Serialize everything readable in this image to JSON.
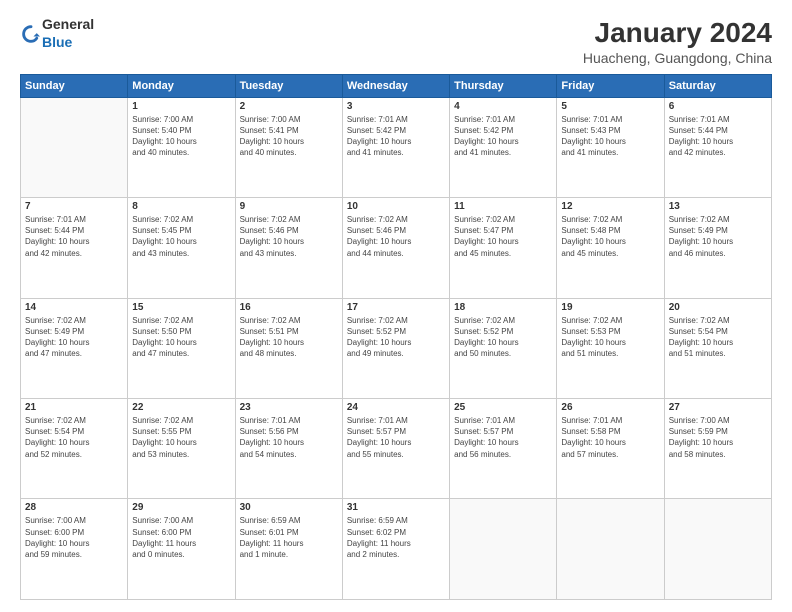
{
  "logo": {
    "general": "General",
    "blue": "Blue"
  },
  "header": {
    "title": "January 2024",
    "subtitle": "Huacheng, Guangdong, China"
  },
  "weekdays": [
    "Sunday",
    "Monday",
    "Tuesday",
    "Wednesday",
    "Thursday",
    "Friday",
    "Saturday"
  ],
  "weeks": [
    [
      {
        "day": "",
        "info": ""
      },
      {
        "day": "1",
        "info": "Sunrise: 7:00 AM\nSunset: 5:40 PM\nDaylight: 10 hours\nand 40 minutes."
      },
      {
        "day": "2",
        "info": "Sunrise: 7:00 AM\nSunset: 5:41 PM\nDaylight: 10 hours\nand 40 minutes."
      },
      {
        "day": "3",
        "info": "Sunrise: 7:01 AM\nSunset: 5:42 PM\nDaylight: 10 hours\nand 41 minutes."
      },
      {
        "day": "4",
        "info": "Sunrise: 7:01 AM\nSunset: 5:42 PM\nDaylight: 10 hours\nand 41 minutes."
      },
      {
        "day": "5",
        "info": "Sunrise: 7:01 AM\nSunset: 5:43 PM\nDaylight: 10 hours\nand 41 minutes."
      },
      {
        "day": "6",
        "info": "Sunrise: 7:01 AM\nSunset: 5:44 PM\nDaylight: 10 hours\nand 42 minutes."
      }
    ],
    [
      {
        "day": "7",
        "info": "Sunrise: 7:01 AM\nSunset: 5:44 PM\nDaylight: 10 hours\nand 42 minutes."
      },
      {
        "day": "8",
        "info": "Sunrise: 7:02 AM\nSunset: 5:45 PM\nDaylight: 10 hours\nand 43 minutes."
      },
      {
        "day": "9",
        "info": "Sunrise: 7:02 AM\nSunset: 5:46 PM\nDaylight: 10 hours\nand 43 minutes."
      },
      {
        "day": "10",
        "info": "Sunrise: 7:02 AM\nSunset: 5:46 PM\nDaylight: 10 hours\nand 44 minutes."
      },
      {
        "day": "11",
        "info": "Sunrise: 7:02 AM\nSunset: 5:47 PM\nDaylight: 10 hours\nand 45 minutes."
      },
      {
        "day": "12",
        "info": "Sunrise: 7:02 AM\nSunset: 5:48 PM\nDaylight: 10 hours\nand 45 minutes."
      },
      {
        "day": "13",
        "info": "Sunrise: 7:02 AM\nSunset: 5:49 PM\nDaylight: 10 hours\nand 46 minutes."
      }
    ],
    [
      {
        "day": "14",
        "info": "Sunrise: 7:02 AM\nSunset: 5:49 PM\nDaylight: 10 hours\nand 47 minutes."
      },
      {
        "day": "15",
        "info": "Sunrise: 7:02 AM\nSunset: 5:50 PM\nDaylight: 10 hours\nand 47 minutes."
      },
      {
        "day": "16",
        "info": "Sunrise: 7:02 AM\nSunset: 5:51 PM\nDaylight: 10 hours\nand 48 minutes."
      },
      {
        "day": "17",
        "info": "Sunrise: 7:02 AM\nSunset: 5:52 PM\nDaylight: 10 hours\nand 49 minutes."
      },
      {
        "day": "18",
        "info": "Sunrise: 7:02 AM\nSunset: 5:52 PM\nDaylight: 10 hours\nand 50 minutes."
      },
      {
        "day": "19",
        "info": "Sunrise: 7:02 AM\nSunset: 5:53 PM\nDaylight: 10 hours\nand 51 minutes."
      },
      {
        "day": "20",
        "info": "Sunrise: 7:02 AM\nSunset: 5:54 PM\nDaylight: 10 hours\nand 51 minutes."
      }
    ],
    [
      {
        "day": "21",
        "info": "Sunrise: 7:02 AM\nSunset: 5:54 PM\nDaylight: 10 hours\nand 52 minutes."
      },
      {
        "day": "22",
        "info": "Sunrise: 7:02 AM\nSunset: 5:55 PM\nDaylight: 10 hours\nand 53 minutes."
      },
      {
        "day": "23",
        "info": "Sunrise: 7:01 AM\nSunset: 5:56 PM\nDaylight: 10 hours\nand 54 minutes."
      },
      {
        "day": "24",
        "info": "Sunrise: 7:01 AM\nSunset: 5:57 PM\nDaylight: 10 hours\nand 55 minutes."
      },
      {
        "day": "25",
        "info": "Sunrise: 7:01 AM\nSunset: 5:57 PM\nDaylight: 10 hours\nand 56 minutes."
      },
      {
        "day": "26",
        "info": "Sunrise: 7:01 AM\nSunset: 5:58 PM\nDaylight: 10 hours\nand 57 minutes."
      },
      {
        "day": "27",
        "info": "Sunrise: 7:00 AM\nSunset: 5:59 PM\nDaylight: 10 hours\nand 58 minutes."
      }
    ],
    [
      {
        "day": "28",
        "info": "Sunrise: 7:00 AM\nSunset: 6:00 PM\nDaylight: 10 hours\nand 59 minutes."
      },
      {
        "day": "29",
        "info": "Sunrise: 7:00 AM\nSunset: 6:00 PM\nDaylight: 11 hours\nand 0 minutes."
      },
      {
        "day": "30",
        "info": "Sunrise: 6:59 AM\nSunset: 6:01 PM\nDaylight: 11 hours\nand 1 minute."
      },
      {
        "day": "31",
        "info": "Sunrise: 6:59 AM\nSunset: 6:02 PM\nDaylight: 11 hours\nand 2 minutes."
      },
      {
        "day": "",
        "info": ""
      },
      {
        "day": "",
        "info": ""
      },
      {
        "day": "",
        "info": ""
      }
    ]
  ]
}
